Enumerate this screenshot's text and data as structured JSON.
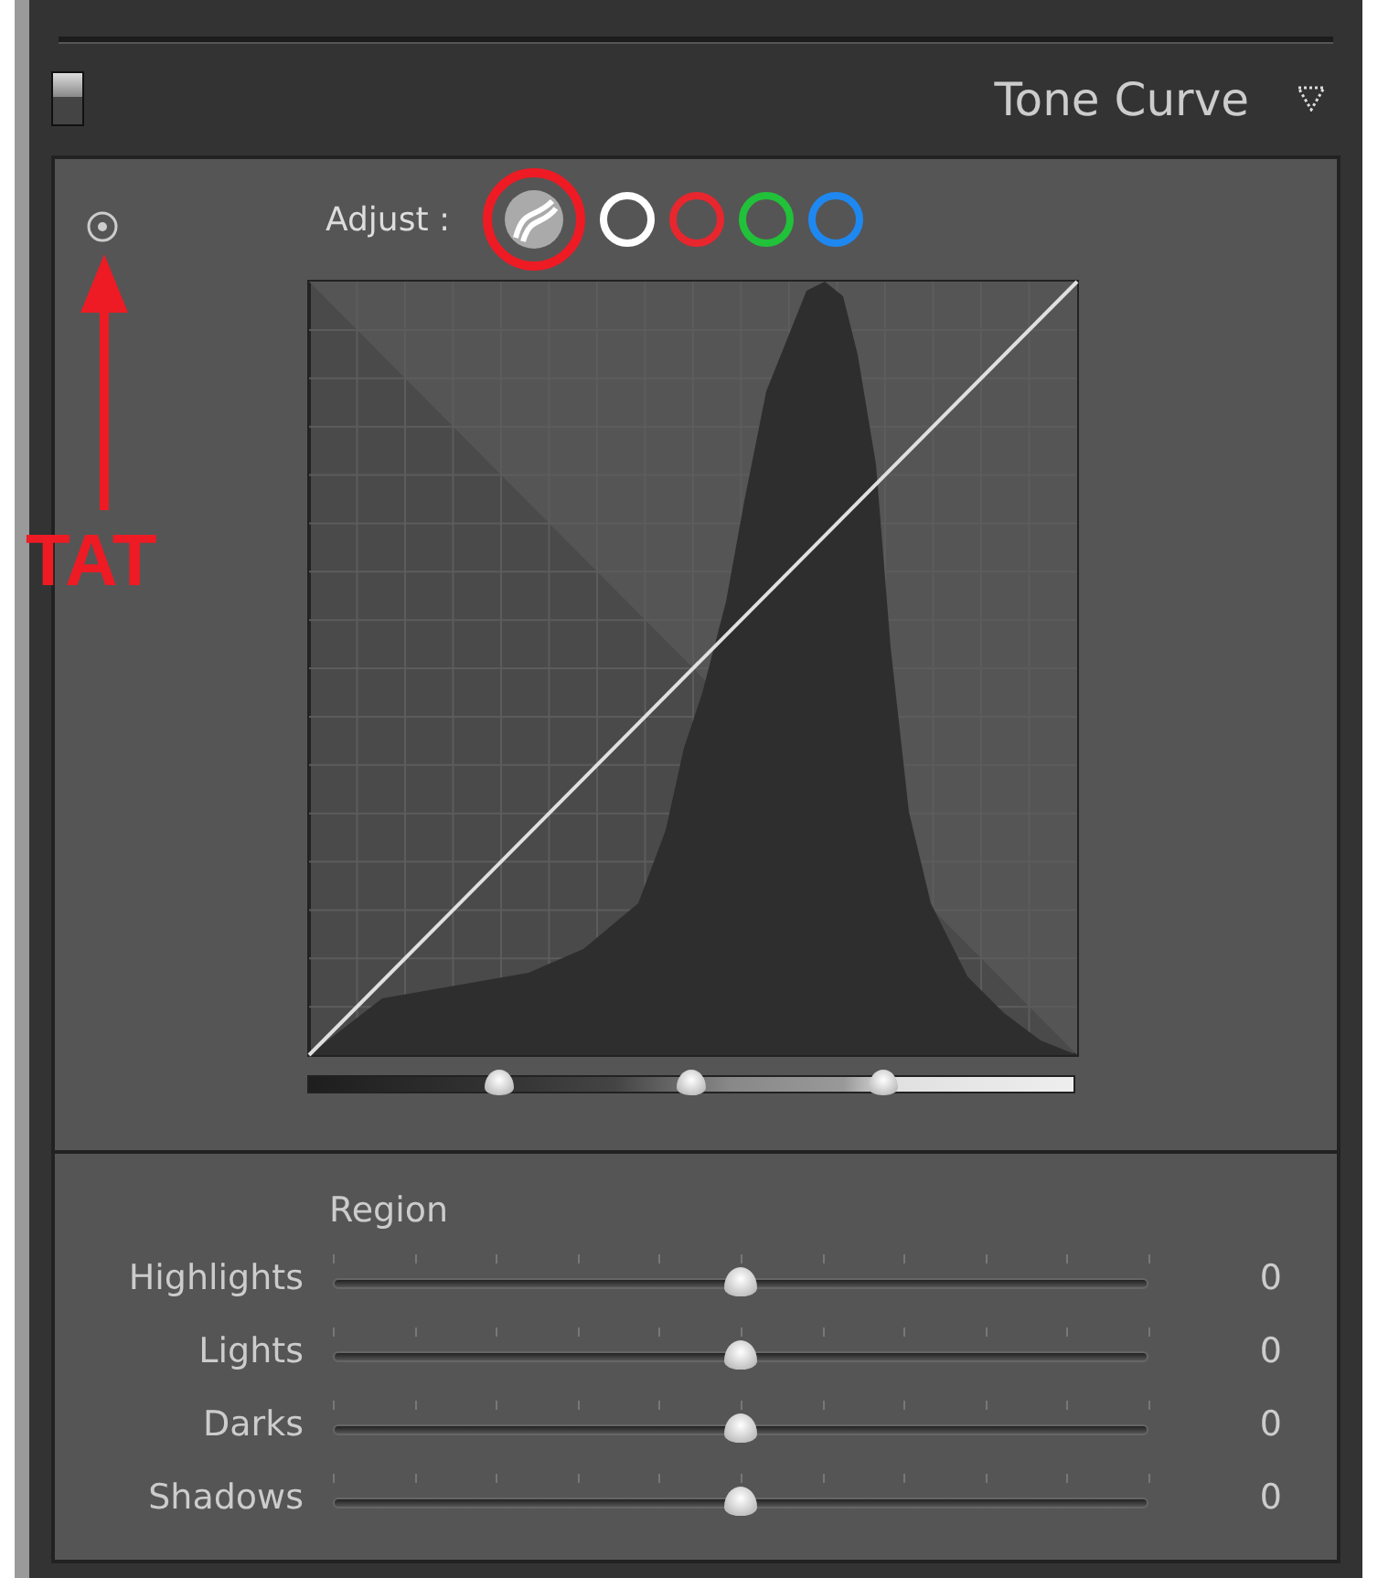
{
  "panel": {
    "title": "Tone Curve",
    "enabled": true
  },
  "adjust": {
    "label": "Adjust :",
    "channels": [
      {
        "kind": "parametric",
        "selected": true
      },
      {
        "kind": "rgb",
        "color": "#ffffff",
        "selected": false
      },
      {
        "kind": "channel",
        "color": "#e8262e",
        "selected": false
      },
      {
        "kind": "channel",
        "color": "#21c13a",
        "selected": false
      },
      {
        "kind": "channel",
        "color": "#1e88f0",
        "selected": false
      }
    ]
  },
  "annotation": {
    "label": "TAT"
  },
  "split_points": [
    {
      "level": 0.25
    },
    {
      "level": 0.5
    },
    {
      "level": 0.75
    }
  ],
  "region": {
    "label": "Region",
    "sliders": [
      {
        "name": "Highlights",
        "level": 0.5,
        "value": "0"
      },
      {
        "name": "Lights",
        "level": 0.5,
        "value": "0"
      },
      {
        "name": "Darks",
        "level": 0.5,
        "value": "0"
      },
      {
        "name": "Shadows",
        "level": 0.5,
        "value": "0"
      }
    ]
  }
}
